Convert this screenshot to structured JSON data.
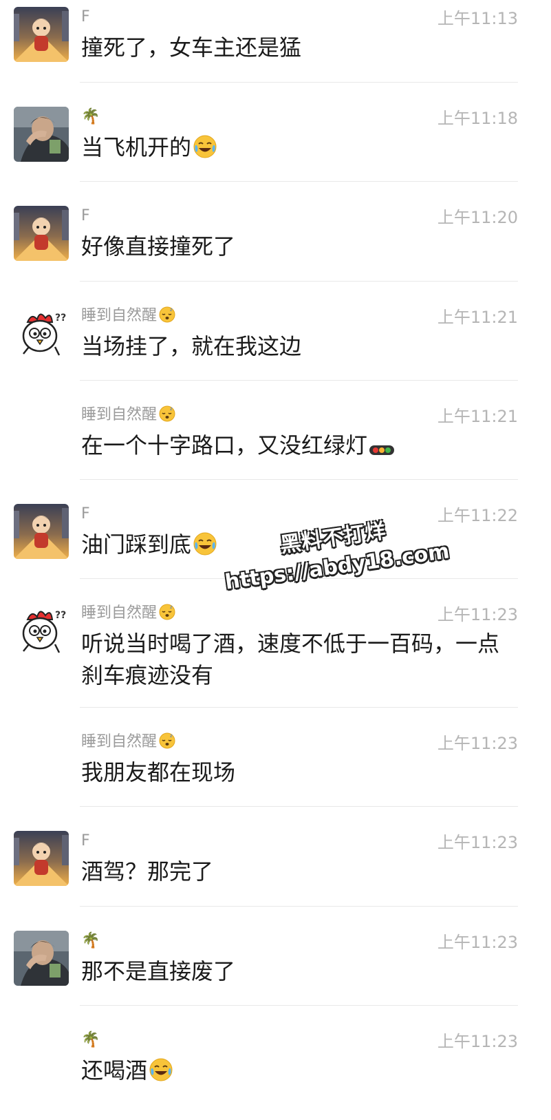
{
  "messages": [
    {
      "name": "F",
      "time": "上午11:13",
      "text": "撞死了，女车主还是猛",
      "avatar": "cartoon-character-avatar",
      "emoji": ""
    },
    {
      "name": "🌴",
      "time": "上午11:18",
      "text": "当飞机开的",
      "avatar": "man-photo-avatar",
      "emoji": "laughing-crying"
    },
    {
      "name": "F",
      "time": "上午11:20",
      "text": "好像直接撞死了",
      "avatar": "cartoon-character-avatar",
      "emoji": ""
    },
    {
      "name": "睡到自然醒",
      "time": "上午11:21",
      "text": "当场挂了，就在我这边",
      "avatar": "confused-chicken-avatar",
      "emoji": "",
      "name_emoji": "sleepy"
    },
    {
      "name": "睡到自然醒",
      "time": "上午11:21",
      "text": "在一个十字路口，又没红绿灯",
      "avatar": "",
      "emoji": "traffic-light",
      "name_emoji": "sleepy"
    },
    {
      "name": "F",
      "time": "上午11:22",
      "text": "油门踩到底",
      "avatar": "cartoon-character-avatar",
      "emoji": "laughing-crying"
    },
    {
      "name": "睡到自然醒",
      "time": "上午11:23",
      "text": "听说当时喝了酒，速度不低于一百码，一点刹车痕迹没有",
      "avatar": "confused-chicken-avatar",
      "emoji": "",
      "name_emoji": "sleepy"
    },
    {
      "name": "睡到自然醒",
      "time": "上午11:23",
      "text": "我朋友都在现场",
      "avatar": "",
      "emoji": "",
      "name_emoji": "sleepy"
    },
    {
      "name": "F",
      "time": "上午11:23",
      "text": "酒驾？那完了",
      "avatar": "cartoon-character-avatar",
      "emoji": ""
    },
    {
      "name": "🌴",
      "time": "上午11:23",
      "text": "那不是直接废了",
      "avatar": "man-photo-avatar",
      "emoji": ""
    },
    {
      "name": "🌴",
      "time": "上午11:23",
      "text": "还喝酒",
      "avatar": "",
      "emoji": "laughing-crying"
    }
  ],
  "watermark": {
    "line1": "黑料不打烊",
    "line2": "https://abdy18.com"
  }
}
